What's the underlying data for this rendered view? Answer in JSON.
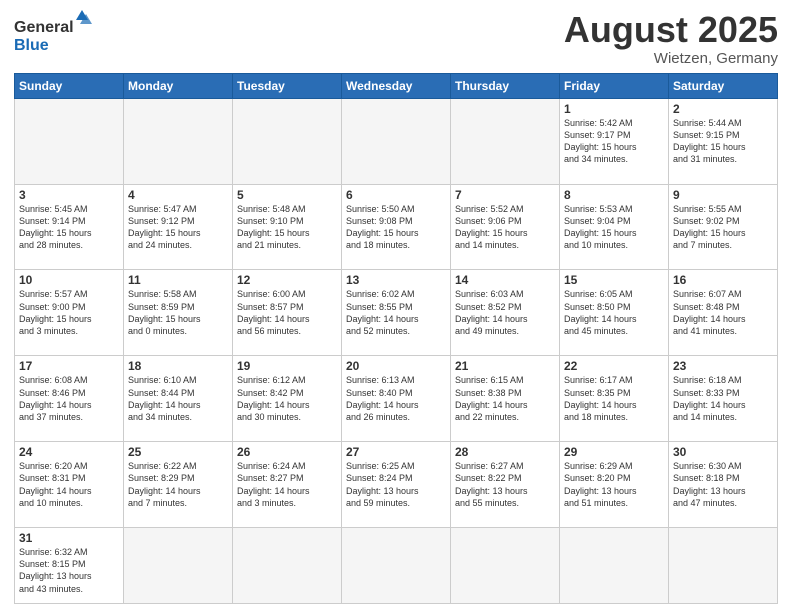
{
  "header": {
    "logo_general": "General",
    "logo_blue": "Blue",
    "month_title": "August 2025",
    "location": "Wietzen, Germany"
  },
  "days_of_week": [
    "Sunday",
    "Monday",
    "Tuesday",
    "Wednesday",
    "Thursday",
    "Friday",
    "Saturday"
  ],
  "weeks": [
    [
      {
        "day": "",
        "info": ""
      },
      {
        "day": "",
        "info": ""
      },
      {
        "day": "",
        "info": ""
      },
      {
        "day": "",
        "info": ""
      },
      {
        "day": "",
        "info": ""
      },
      {
        "day": "1",
        "info": "Sunrise: 5:42 AM\nSunset: 9:17 PM\nDaylight: 15 hours\nand 34 minutes."
      },
      {
        "day": "2",
        "info": "Sunrise: 5:44 AM\nSunset: 9:15 PM\nDaylight: 15 hours\nand 31 minutes."
      }
    ],
    [
      {
        "day": "3",
        "info": "Sunrise: 5:45 AM\nSunset: 9:14 PM\nDaylight: 15 hours\nand 28 minutes."
      },
      {
        "day": "4",
        "info": "Sunrise: 5:47 AM\nSunset: 9:12 PM\nDaylight: 15 hours\nand 24 minutes."
      },
      {
        "day": "5",
        "info": "Sunrise: 5:48 AM\nSunset: 9:10 PM\nDaylight: 15 hours\nand 21 minutes."
      },
      {
        "day": "6",
        "info": "Sunrise: 5:50 AM\nSunset: 9:08 PM\nDaylight: 15 hours\nand 18 minutes."
      },
      {
        "day": "7",
        "info": "Sunrise: 5:52 AM\nSunset: 9:06 PM\nDaylight: 15 hours\nand 14 minutes."
      },
      {
        "day": "8",
        "info": "Sunrise: 5:53 AM\nSunset: 9:04 PM\nDaylight: 15 hours\nand 10 minutes."
      },
      {
        "day": "9",
        "info": "Sunrise: 5:55 AM\nSunset: 9:02 PM\nDaylight: 15 hours\nand 7 minutes."
      }
    ],
    [
      {
        "day": "10",
        "info": "Sunrise: 5:57 AM\nSunset: 9:00 PM\nDaylight: 15 hours\nand 3 minutes."
      },
      {
        "day": "11",
        "info": "Sunrise: 5:58 AM\nSunset: 8:59 PM\nDaylight: 15 hours\nand 0 minutes."
      },
      {
        "day": "12",
        "info": "Sunrise: 6:00 AM\nSunset: 8:57 PM\nDaylight: 14 hours\nand 56 minutes."
      },
      {
        "day": "13",
        "info": "Sunrise: 6:02 AM\nSunset: 8:55 PM\nDaylight: 14 hours\nand 52 minutes."
      },
      {
        "day": "14",
        "info": "Sunrise: 6:03 AM\nSunset: 8:52 PM\nDaylight: 14 hours\nand 49 minutes."
      },
      {
        "day": "15",
        "info": "Sunrise: 6:05 AM\nSunset: 8:50 PM\nDaylight: 14 hours\nand 45 minutes."
      },
      {
        "day": "16",
        "info": "Sunrise: 6:07 AM\nSunset: 8:48 PM\nDaylight: 14 hours\nand 41 minutes."
      }
    ],
    [
      {
        "day": "17",
        "info": "Sunrise: 6:08 AM\nSunset: 8:46 PM\nDaylight: 14 hours\nand 37 minutes."
      },
      {
        "day": "18",
        "info": "Sunrise: 6:10 AM\nSunset: 8:44 PM\nDaylight: 14 hours\nand 34 minutes."
      },
      {
        "day": "19",
        "info": "Sunrise: 6:12 AM\nSunset: 8:42 PM\nDaylight: 14 hours\nand 30 minutes."
      },
      {
        "day": "20",
        "info": "Sunrise: 6:13 AM\nSunset: 8:40 PM\nDaylight: 14 hours\nand 26 minutes."
      },
      {
        "day": "21",
        "info": "Sunrise: 6:15 AM\nSunset: 8:38 PM\nDaylight: 14 hours\nand 22 minutes."
      },
      {
        "day": "22",
        "info": "Sunrise: 6:17 AM\nSunset: 8:35 PM\nDaylight: 14 hours\nand 18 minutes."
      },
      {
        "day": "23",
        "info": "Sunrise: 6:18 AM\nSunset: 8:33 PM\nDaylight: 14 hours\nand 14 minutes."
      }
    ],
    [
      {
        "day": "24",
        "info": "Sunrise: 6:20 AM\nSunset: 8:31 PM\nDaylight: 14 hours\nand 10 minutes."
      },
      {
        "day": "25",
        "info": "Sunrise: 6:22 AM\nSunset: 8:29 PM\nDaylight: 14 hours\nand 7 minutes."
      },
      {
        "day": "26",
        "info": "Sunrise: 6:24 AM\nSunset: 8:27 PM\nDaylight: 14 hours\nand 3 minutes."
      },
      {
        "day": "27",
        "info": "Sunrise: 6:25 AM\nSunset: 8:24 PM\nDaylight: 13 hours\nand 59 minutes."
      },
      {
        "day": "28",
        "info": "Sunrise: 6:27 AM\nSunset: 8:22 PM\nDaylight: 13 hours\nand 55 minutes."
      },
      {
        "day": "29",
        "info": "Sunrise: 6:29 AM\nSunset: 8:20 PM\nDaylight: 13 hours\nand 51 minutes."
      },
      {
        "day": "30",
        "info": "Sunrise: 6:30 AM\nSunset: 8:18 PM\nDaylight: 13 hours\nand 47 minutes."
      }
    ],
    [
      {
        "day": "31",
        "info": "Sunrise: 6:32 AM\nSunset: 8:15 PM\nDaylight: 13 hours\nand 43 minutes."
      },
      {
        "day": "",
        "info": ""
      },
      {
        "day": "",
        "info": ""
      },
      {
        "day": "",
        "info": ""
      },
      {
        "day": "",
        "info": ""
      },
      {
        "day": "",
        "info": ""
      },
      {
        "day": "",
        "info": ""
      }
    ]
  ]
}
